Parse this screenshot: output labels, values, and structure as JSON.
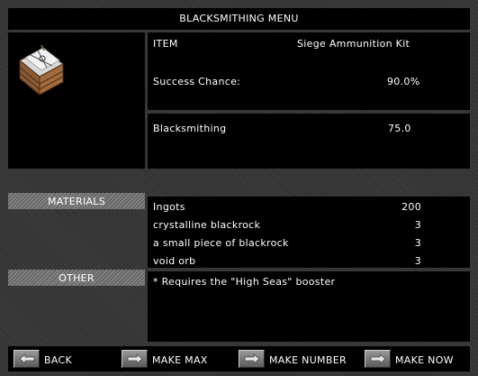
{
  "title": "BLACKSMITHING MENU",
  "item": {
    "header_label": "ITEM",
    "name": "Siege Ammunition Kit",
    "success_label": "Success Chance:",
    "success_value": "90.0%",
    "icon": "crate-icon"
  },
  "skills": [
    {
      "name": "Blacksmithing",
      "value": "75.0"
    }
  ],
  "materials": {
    "header": "MATERIALS",
    "rows": [
      {
        "name": "Ingots",
        "qty": "200"
      },
      {
        "name": "crystalline blackrock",
        "qty": "3"
      },
      {
        "name": "a small piece of blackrock",
        "qty": "3"
      },
      {
        "name": "void orb",
        "qty": "3"
      }
    ]
  },
  "other": {
    "header": "OTHER",
    "note": "* Requires the \"High Seas\" booster"
  },
  "buttons": {
    "back": "BACK",
    "make_max": "MAKE MAX",
    "make_number": "MAKE NUMBER",
    "make_now": "MAKE NOW"
  },
  "colors": {
    "frame": "#3a3a3a",
    "panel": "#000000",
    "text": "#ffffff",
    "hatch": "#777777"
  }
}
